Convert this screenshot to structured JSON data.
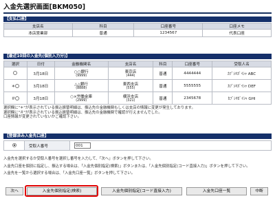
{
  "page": {
    "title": "入金先選択画面[BKM050]"
  },
  "payment_source": {
    "header": "【支払口座】",
    "columns": [
      "支店名",
      "科目",
      "口座番号",
      "口座メモ"
    ],
    "row": [
      "本店営業部",
      "普通",
      "1234567",
      "代表口座"
    ]
  },
  "recent": {
    "header": "【最近10回の入金先(個別入力分)】",
    "columns": [
      "選択",
      "日付",
      "金融機関名",
      "支店名",
      "科目",
      "口座番号",
      "受取人名"
    ],
    "rows": [
      {
        "mark": "",
        "date": "3月18日",
        "bank": "○○銀行",
        "bank_code": "(9999)",
        "branch": "東京店",
        "branch_code": "(444)",
        "type": "普通",
        "account": "4444444",
        "payee": "ｶﾌﾞｼｷｶﾞｲｼｬ ABC",
        "selected": false
      },
      {
        "mark": "＊",
        "date": "3月18日",
        "bank": "△△銀行",
        "bank_code": "(8888)",
        "branch": "東西支店",
        "branch_code": "(555)",
        "type": "普通",
        "account": "5555555",
        "payee": "ｶﾌﾞｼｷｶﾞｲｼｬ DEF",
        "selected": false
      },
      {
        "mark": "＃",
        "date": "3月18日",
        "bank": "○×労働金庫",
        "bank_code": "(2999)",
        "branch": "横浜支店",
        "branch_code": "(321)",
        "type": "普通",
        "account": "2345678",
        "payee": "ｶﾌﾞｼｷｶﾞｲｼｬ GHI",
        "selected": false
      }
    ],
    "notes": [
      "選択欄に\"＊\"が表示されている振込振替明細は、振込先の金融機関もしくは支店の情報に変更が発生しております。",
      "選択欄に\"＃\"が表示されている振込振替明細は、振込先の金融機関で確認が行えませんでした。",
      "口座情報が変更されていないかご確認下さい。"
    ]
  },
  "registered": {
    "header": "【登録済み入金先口座】",
    "label": "受取人番号",
    "value": "001",
    "selected": true
  },
  "instructions": [
    "入金先を選択するか受取人番号を選択し番号を入力して、「次へ」ボタンを押して下さい。",
    "入金先口座を個別に指定し、振込する場合は、「入金先個別指定(検索)」ボタンまたは、「入金先個別指定(コード直接入力)」ボタンを押して下さい。",
    "入金先を一覧から選択する場合は、「入金先口座一覧」ボタンを押して下さい。"
  ],
  "buttons": {
    "next": "次へ",
    "search": "入金先個別指定(検索)",
    "direct": "入金先個別指定(コード直接入力)",
    "list": "入金先口座一覧",
    "cancel": "中断"
  }
}
